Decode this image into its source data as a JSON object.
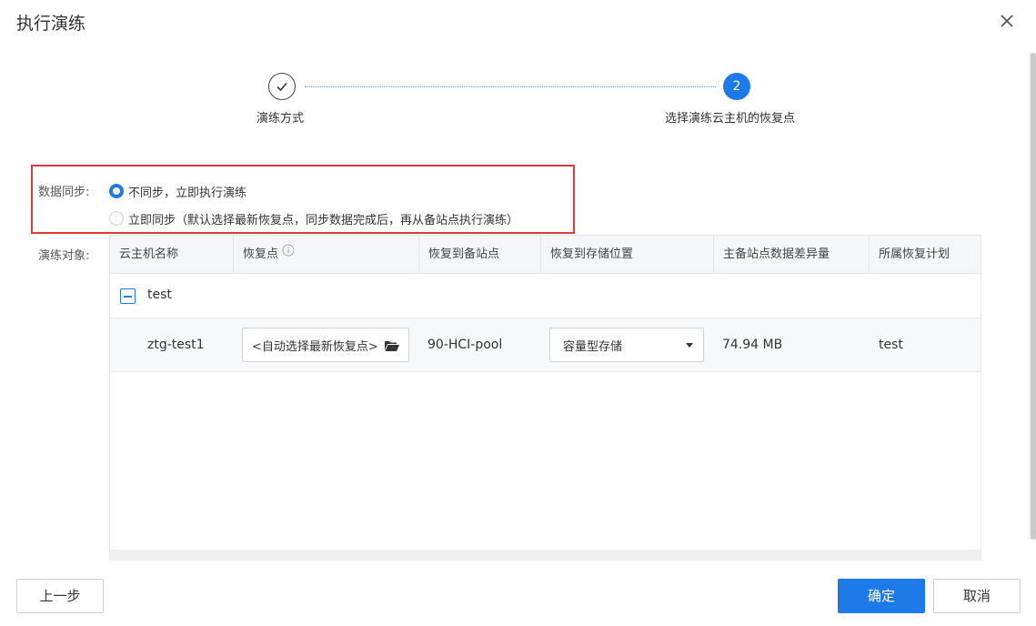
{
  "dialog": {
    "title": "执行演练"
  },
  "steps": [
    {
      "label": "演练方式",
      "state": "done"
    },
    {
      "number": "2",
      "label": "选择演练云主机的恢复点",
      "state": "active"
    }
  ],
  "sync": {
    "label": "数据同步:",
    "options": [
      {
        "text": "不同步，立即执行演练",
        "selected": true
      },
      {
        "text": "立即同步（默认选择最新恢复点，同步数据完成后，再从备站点执行演练）",
        "selected": false
      }
    ]
  },
  "target": {
    "label": "演练对象:"
  },
  "table": {
    "columns": [
      "云主机名称",
      "恢复点",
      "恢复到备站点",
      "恢复到存储位置",
      "主备站点数据差异量",
      "所属恢复计划"
    ],
    "group": {
      "name": "test"
    },
    "rows": [
      {
        "vm_name": "ztg-test1",
        "restore_point": "<自动选择最新恢复点>",
        "standby_site": "90-HCI-pool",
        "storage": "容量型存储",
        "diff": "74.94 MB",
        "plan": "test"
      }
    ]
  },
  "buttons": {
    "prev": "上一步",
    "ok": "确定",
    "cancel": "取消"
  },
  "colors": {
    "accent": "#1e7ae8",
    "highlight_border": "#e23a3a"
  }
}
